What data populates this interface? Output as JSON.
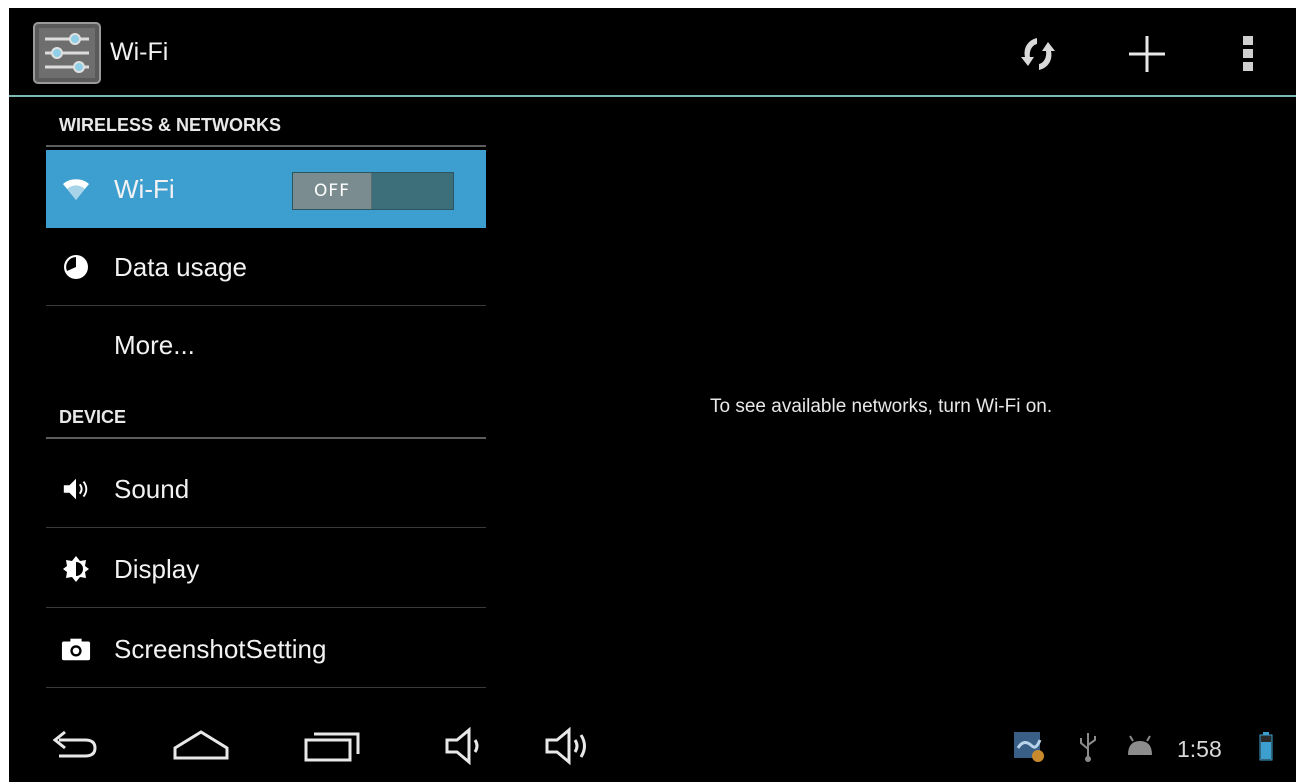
{
  "actionbar": {
    "title": "Wi-Fi",
    "icons": [
      "settings-icon",
      "refresh-icon",
      "add-icon",
      "overflow-menu-icon"
    ]
  },
  "sections": {
    "wireless": "WIRELESS & NETWORKS",
    "device": "DEVICE"
  },
  "items": {
    "wifi": {
      "label": "Wi-Fi",
      "icon": "wifi-icon",
      "toggle": "OFF"
    },
    "data_usage": {
      "label": "Data usage",
      "icon": "data-usage-icon"
    },
    "more": {
      "label": "More..."
    },
    "sound": {
      "label": "Sound",
      "icon": "speaker-icon"
    },
    "display": {
      "label": "Display",
      "icon": "brightness-icon"
    },
    "screenshot": {
      "label": "ScreenshotSetting",
      "icon": "camera-icon"
    }
  },
  "main": {
    "message": "To see available networks, turn Wi-Fi on."
  },
  "sysbar": {
    "clock": "1:58",
    "nav_icons": [
      "back-icon",
      "home-icon",
      "recent-apps-icon",
      "volume-down-icon",
      "volume-up-icon"
    ],
    "status_icons": [
      "notification-app-icon",
      "usb-icon",
      "android-debug-icon",
      "battery-icon"
    ]
  },
  "colors": {
    "accent": "#3d9fcf",
    "actionbar_rule": "#7fb7b4",
    "toggle_track": "#3d6f7a",
    "toggle_knob": "#7a8c8f"
  }
}
